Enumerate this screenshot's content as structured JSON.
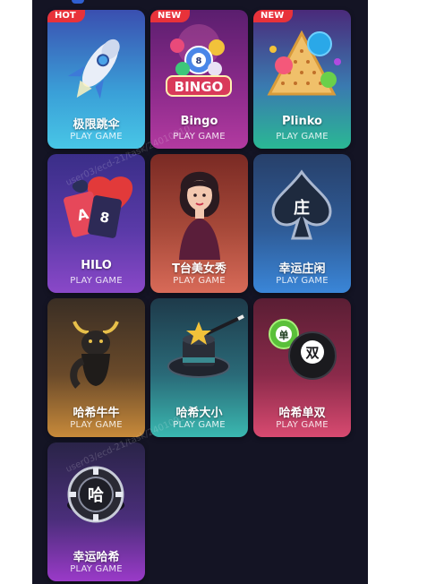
{
  "games": [
    {
      "title": "极限跳伞",
      "subtitle": "PLAY GAME",
      "badge": "HOT",
      "icon": "rocket-icon"
    },
    {
      "title": "Bingo",
      "subtitle": "PLAY GAME",
      "badge": "NEW",
      "icon": "bingo-balls-icon"
    },
    {
      "title": "Plinko",
      "subtitle": "PLAY GAME",
      "badge": "NEW",
      "icon": "plinko-board-icon"
    },
    {
      "title": "HILO",
      "subtitle": "PLAY GAME",
      "badge": "",
      "icon": "playing-cards-icon"
    },
    {
      "title": "T台美女秀",
      "subtitle": "PLAY GAME",
      "badge": "",
      "icon": "model-woman-icon"
    },
    {
      "title": "幸运庄闲",
      "subtitle": "PLAY GAME",
      "badge": "",
      "icon": "spade-icon"
    },
    {
      "title": "哈希牛牛",
      "subtitle": "PLAY GAME",
      "badge": "",
      "icon": "bull-icon"
    },
    {
      "title": "哈希大小",
      "subtitle": "PLAY GAME",
      "badge": "",
      "icon": "magic-hat-icon"
    },
    {
      "title": "哈希单双",
      "subtitle": "PLAY GAME",
      "badge": "",
      "icon": "odd-even-balls-icon"
    },
    {
      "title": "幸运哈希",
      "subtitle": "PLAY GAME",
      "badge": "",
      "icon": "poker-chip-icon"
    }
  ],
  "spade_label": "庄",
  "bingo_word": "BINGO",
  "ball_odd": "单",
  "ball_even": "双",
  "chip_label": "哈",
  "watermark": "user03/ecd-21/task/24010910",
  "colors": {
    "background": "#141424",
    "badge": "#e8323a"
  }
}
